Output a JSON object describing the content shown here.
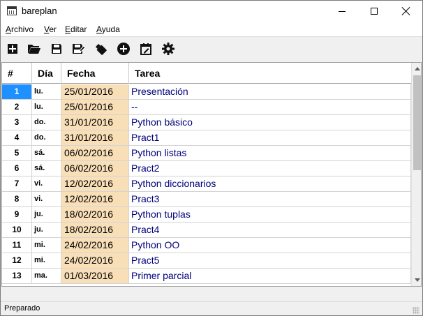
{
  "window": {
    "title": "bareplan"
  },
  "menu": [
    {
      "accel": "A",
      "rest": "rchivo"
    },
    {
      "accel": "V",
      "rest": "er"
    },
    {
      "accel": "E",
      "rest": "ditar"
    },
    {
      "accel": "A",
      "rest": "yuda"
    }
  ],
  "toolbar": [
    "new-icon",
    "open-folder-icon",
    "save-icon",
    "save-as-icon",
    "usb-drive-icon",
    "add-circle-icon",
    "calendar-edit-icon",
    "gear-icon"
  ],
  "table": {
    "columns": [
      "#",
      "Día",
      "Fecha",
      "Tarea"
    ],
    "selected_row": 1,
    "rows": [
      {
        "num": "1",
        "dia": "lu.",
        "fecha": "25/01/2016",
        "tarea": "Presentación"
      },
      {
        "num": "2",
        "dia": "lu.",
        "fecha": "25/01/2016",
        "tarea": "--"
      },
      {
        "num": "3",
        "dia": "do.",
        "fecha": "31/01/2016",
        "tarea": "Python básico"
      },
      {
        "num": "4",
        "dia": "do.",
        "fecha": "31/01/2016",
        "tarea": "Pract1"
      },
      {
        "num": "5",
        "dia": "sá.",
        "fecha": "06/02/2016",
        "tarea": "Python listas"
      },
      {
        "num": "6",
        "dia": "sá.",
        "fecha": "06/02/2016",
        "tarea": "Pract2"
      },
      {
        "num": "7",
        "dia": "vi.",
        "fecha": "12/02/2016",
        "tarea": "Python diccionarios"
      },
      {
        "num": "8",
        "dia": "vi.",
        "fecha": "12/02/2016",
        "tarea": "Pract3"
      },
      {
        "num": "9",
        "dia": "ju.",
        "fecha": "18/02/2016",
        "tarea": "Python tuplas"
      },
      {
        "num": "10",
        "dia": "ju.",
        "fecha": "18/02/2016",
        "tarea": "Pract4"
      },
      {
        "num": "11",
        "dia": "mi.",
        "fecha": "24/02/2016",
        "tarea": "Python OO"
      },
      {
        "num": "12",
        "dia": "mi.",
        "fecha": "24/02/2016",
        "tarea": "Pract5"
      },
      {
        "num": "13",
        "dia": "ma.",
        "fecha": "01/03/2016",
        "tarea": "Primer parcial"
      }
    ]
  },
  "status": {
    "text": "Preparado"
  },
  "colors": {
    "selection": "#1e90ff",
    "date_cell": "#f8dfb8",
    "task_text": "#00007a"
  }
}
